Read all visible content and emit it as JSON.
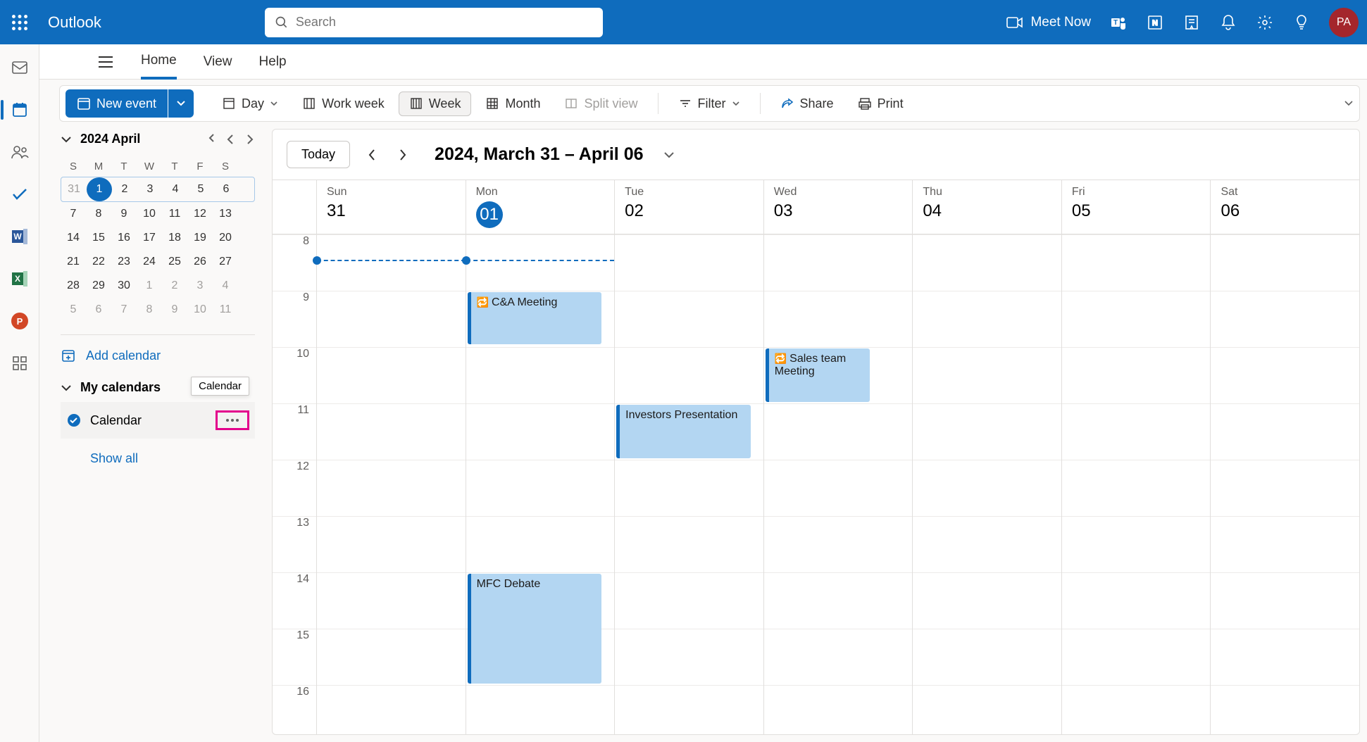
{
  "app": {
    "brand": "Outlook",
    "search_placeholder": "Search",
    "meet_now": "Meet Now",
    "avatar_initials": "PA"
  },
  "tabs": {
    "home": "Home",
    "view": "View",
    "help": "Help"
  },
  "toolbar": {
    "new_event": "New event",
    "day": "Day",
    "work_week": "Work week",
    "week": "Week",
    "month": "Month",
    "split_view": "Split view",
    "filter": "Filter",
    "share": "Share",
    "print": "Print"
  },
  "sidebar": {
    "month_label": "2024 April",
    "dow": [
      "S",
      "M",
      "T",
      "W",
      "T",
      "F",
      "S"
    ],
    "weeks": [
      [
        "31",
        "1",
        "2",
        "3",
        "4",
        "5",
        "6"
      ],
      [
        "7",
        "8",
        "9",
        "10",
        "11",
        "12",
        "13"
      ],
      [
        "14",
        "15",
        "16",
        "17",
        "18",
        "19",
        "20"
      ],
      [
        "21",
        "22",
        "23",
        "24",
        "25",
        "26",
        "27"
      ],
      [
        "28",
        "29",
        "30",
        "1",
        "2",
        "3",
        "4"
      ],
      [
        "5",
        "6",
        "7",
        "8",
        "9",
        "10",
        "11"
      ]
    ],
    "add_calendar": "Add calendar",
    "my_calendars": "My calendars",
    "calendar_item": "Calendar",
    "tooltip": "Calendar",
    "show_all": "Show all"
  },
  "calendar": {
    "today_btn": "Today",
    "range": "2024, March 31 – April 06",
    "days": [
      {
        "dow": "Sun",
        "num": "31"
      },
      {
        "dow": "Mon",
        "num": "01"
      },
      {
        "dow": "Tue",
        "num": "02"
      },
      {
        "dow": "Wed",
        "num": "03"
      },
      {
        "dow": "Thu",
        "num": "04"
      },
      {
        "dow": "Fri",
        "num": "05"
      },
      {
        "dow": "Sat",
        "num": "06"
      }
    ],
    "hours": [
      "8",
      "9",
      "10",
      "11",
      "12",
      "13",
      "14",
      "15",
      "16"
    ],
    "events": {
      "ca_meeting": "C&A Meeting",
      "sales_team": "Sales team Meeting",
      "investors": "Investors Presentation",
      "mfc_debate": "MFC Debate"
    }
  }
}
